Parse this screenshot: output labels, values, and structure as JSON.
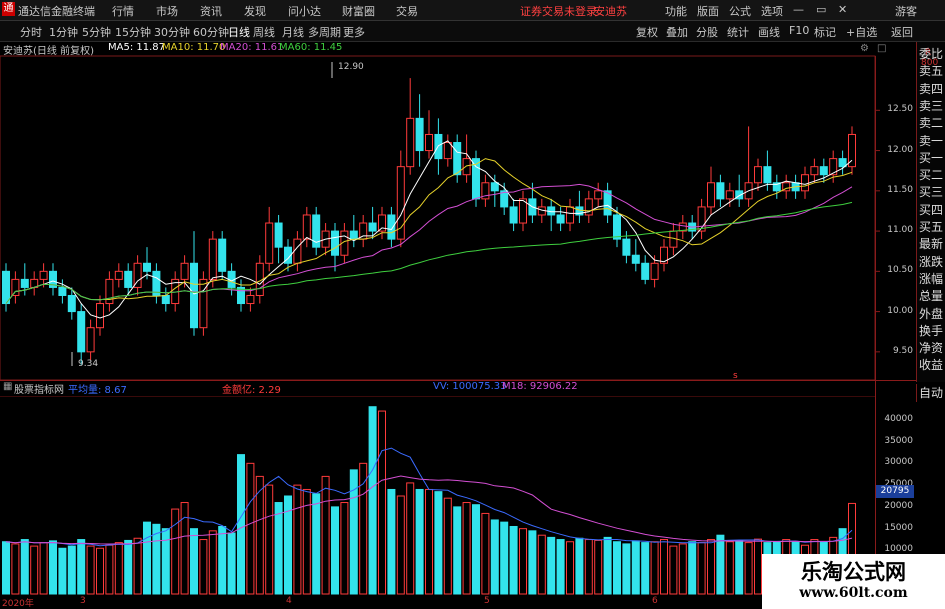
{
  "app": {
    "title": "通达信金融终端",
    "menus": [
      "行情",
      "市场",
      "资讯",
      "发现",
      "问小达",
      "财富圈",
      "交易"
    ],
    "alert": "证券交易未登录",
    "stock_tag": "安迪苏",
    "right_menus": [
      "功能",
      "版面",
      "公式",
      "选项"
    ],
    "guest": "游客",
    "colors": {
      "up": "#ff3b3b",
      "down": "#33e3ec",
      "ma5": "#ffffff",
      "ma10": "#e6d22b",
      "ma20": "#d34fd3",
      "ma60": "#3fcf3f"
    }
  },
  "toolbar": {
    "periods": [
      "分时",
      "1分钟",
      "5分钟",
      "15分钟",
      "30分钟",
      "60分钟",
      "日线",
      "周线",
      "月线",
      "多周期",
      "更多"
    ],
    "right_buttons": [
      "复权",
      "叠加",
      "分股",
      "统计",
      "画线",
      "F10",
      "标记",
      "+自选",
      "返回"
    ]
  },
  "chart_header": {
    "stock": "安迪苏(日线 前复权)",
    "ma5": "MA5: 11.87",
    "ma10": "MA10: 11.70",
    "ma20": "MA20: 11.61",
    "ma60": "MA60: 11.45"
  },
  "price_axis": [
    "12.50",
    "12.00",
    "11.50",
    "11.00",
    "10.50",
    "10.00",
    "9.50"
  ],
  "annotations": {
    "high": "12.90",
    "low": "9.34"
  },
  "side_panel": [
    "委比",
    "卖五",
    "卖四",
    "卖三",
    "卖二",
    "卖一",
    "买一",
    "买二",
    "买三",
    "买四",
    "买五",
    "最新",
    "涨跌",
    "涨幅",
    "总量",
    "外盘",
    "换手",
    "净资",
    "收益"
  ],
  "side_panel_bottom": "自动",
  "volume_panel": {
    "title": "股票指标网",
    "indicator1": "平均量: 8.67",
    "indicator2": "金额亿: 2.29",
    "vol": "VV: 100075.33",
    "m18": "M18: 92906.22",
    "axis": [
      "40000",
      "35000",
      "30000",
      "25000",
      "20000",
      "15000",
      "10000"
    ],
    "marker": "20795"
  },
  "date_axis": [
    "2020年",
    "3",
    "4",
    "5",
    "6"
  ],
  "watermark": {
    "title": "乐淘公式网",
    "url": "www.60lt.com"
  },
  "chart_data": {
    "type": "candlestick",
    "title": "安迪苏(日线 前复权)",
    "ylim": [
      9.2,
      13.1
    ],
    "candles": [
      [
        10.5,
        10.1,
        10.6,
        10.0
      ],
      [
        10.2,
        10.4,
        10.5,
        10.1
      ],
      [
        10.4,
        10.3,
        10.6,
        10.2
      ],
      [
        10.3,
        10.4,
        10.5,
        10.2
      ],
      [
        10.4,
        10.5,
        10.6,
        10.3
      ],
      [
        10.5,
        10.3,
        10.6,
        10.2
      ],
      [
        10.3,
        10.2,
        10.4,
        10.1
      ],
      [
        10.2,
        10.0,
        10.3,
        9.9
      ],
      [
        10.0,
        9.5,
        10.1,
        9.34
      ],
      [
        9.5,
        9.8,
        9.9,
        9.4
      ],
      [
        9.8,
        10.1,
        10.2,
        9.7
      ],
      [
        10.1,
        10.4,
        10.5,
        10.0
      ],
      [
        10.4,
        10.5,
        10.6,
        10.3
      ],
      [
        10.5,
        10.3,
        10.6,
        10.2
      ],
      [
        10.3,
        10.6,
        10.7,
        10.2
      ],
      [
        10.6,
        10.5,
        10.8,
        10.4
      ],
      [
        10.5,
        10.2,
        10.6,
        10.1
      ],
      [
        10.2,
        10.1,
        10.3,
        10.0
      ],
      [
        10.1,
        10.4,
        10.5,
        10.0
      ],
      [
        10.4,
        10.6,
        10.7,
        10.3
      ],
      [
        10.6,
        9.8,
        11.0,
        9.7
      ],
      [
        9.8,
        10.4,
        10.5,
        9.7
      ],
      [
        10.4,
        10.9,
        11.0,
        10.3
      ],
      [
        10.9,
        10.5,
        11.0,
        10.4
      ],
      [
        10.5,
        10.3,
        10.6,
        10.2
      ],
      [
        10.3,
        10.1,
        10.4,
        10.0
      ],
      [
        10.1,
        10.2,
        10.3,
        10.0
      ],
      [
        10.2,
        10.6,
        10.7,
        10.1
      ],
      [
        10.6,
        11.1,
        11.3,
        10.5
      ],
      [
        11.1,
        10.8,
        11.2,
        10.6
      ],
      [
        10.8,
        10.6,
        10.9,
        10.5
      ],
      [
        10.6,
        10.9,
        11.0,
        10.5
      ],
      [
        10.9,
        11.2,
        11.3,
        10.8
      ],
      [
        11.2,
        10.8,
        11.3,
        10.7
      ],
      [
        10.8,
        11.0,
        11.1,
        10.7
      ],
      [
        11.0,
        10.7,
        11.1,
        10.5
      ],
      [
        10.7,
        11.0,
        11.1,
        10.6
      ],
      [
        11.0,
        10.9,
        11.2,
        10.8
      ],
      [
        10.9,
        11.1,
        11.2,
        10.8
      ],
      [
        11.1,
        11.0,
        11.3,
        10.9
      ],
      [
        11.0,
        11.2,
        11.3,
        10.9
      ],
      [
        11.2,
        10.9,
        11.3,
        10.8
      ],
      [
        10.9,
        11.8,
        12.0,
        10.8
      ],
      [
        11.8,
        12.4,
        12.9,
        11.7
      ],
      [
        12.4,
        12.0,
        12.7,
        11.8
      ],
      [
        12.0,
        12.2,
        12.5,
        11.9
      ],
      [
        12.2,
        11.9,
        12.4,
        11.7
      ],
      [
        11.9,
        12.1,
        12.2,
        11.8
      ],
      [
        12.1,
        11.7,
        12.2,
        11.6
      ],
      [
        11.7,
        11.9,
        12.2,
        11.6
      ],
      [
        11.9,
        11.4,
        12.0,
        11.3
      ],
      [
        11.4,
        11.6,
        11.7,
        11.3
      ],
      [
        11.6,
        11.5,
        11.7,
        11.3
      ],
      [
        11.5,
        11.3,
        11.6,
        11.2
      ],
      [
        11.3,
        11.1,
        11.4,
        11.0
      ],
      [
        11.1,
        11.4,
        11.5,
        11.0
      ],
      [
        11.4,
        11.2,
        11.6,
        11.1
      ],
      [
        11.2,
        11.3,
        11.4,
        11.1
      ],
      [
        11.3,
        11.2,
        11.4,
        11.0
      ],
      [
        11.2,
        11.1,
        11.3,
        11.0
      ],
      [
        11.1,
        11.3,
        11.4,
        11.0
      ],
      [
        11.3,
        11.2,
        11.5,
        11.1
      ],
      [
        11.2,
        11.4,
        11.5,
        11.1
      ],
      [
        11.4,
        11.5,
        11.6,
        11.3
      ],
      [
        11.5,
        11.2,
        11.6,
        11.1
      ],
      [
        11.2,
        10.9,
        11.3,
        10.8
      ],
      [
        10.9,
        10.7,
        11.0,
        10.6
      ],
      [
        10.7,
        10.6,
        10.9,
        10.5
      ],
      [
        10.6,
        10.4,
        10.7,
        10.34
      ],
      [
        10.4,
        10.6,
        10.7,
        10.3
      ],
      [
        10.6,
        10.8,
        10.9,
        10.5
      ],
      [
        10.8,
        11.0,
        11.1,
        10.7
      ],
      [
        11.0,
        11.1,
        11.2,
        10.9
      ],
      [
        11.1,
        11.0,
        11.2,
        10.9
      ],
      [
        11.0,
        11.3,
        11.4,
        10.9
      ],
      [
        11.3,
        11.6,
        11.8,
        11.2
      ],
      [
        11.6,
        11.4,
        11.7,
        11.3
      ],
      [
        11.4,
        11.5,
        11.6,
        11.3
      ],
      [
        11.5,
        11.4,
        11.7,
        11.3
      ],
      [
        11.4,
        11.6,
        12.3,
        11.3
      ],
      [
        11.6,
        11.8,
        11.9,
        11.5
      ],
      [
        11.8,
        11.6,
        12.0,
        11.5
      ],
      [
        11.6,
        11.5,
        11.7,
        11.4
      ],
      [
        11.5,
        11.6,
        11.7,
        11.4
      ],
      [
        11.6,
        11.5,
        11.7,
        11.4
      ],
      [
        11.5,
        11.7,
        11.8,
        11.4
      ],
      [
        11.7,
        11.8,
        11.9,
        11.6
      ],
      [
        11.8,
        11.7,
        11.9,
        11.6
      ],
      [
        11.7,
        11.9,
        12.0,
        11.6
      ],
      [
        11.9,
        11.8,
        12.0,
        11.7
      ],
      [
        11.8,
        12.2,
        12.3,
        11.7
      ]
    ],
    "volumes": [
      12000,
      11500,
      12500,
      11000,
      11800,
      12200,
      10500,
      11000,
      12500,
      11000,
      10500,
      11200,
      11800,
      12300,
      12800,
      16500,
      16000,
      15000,
      19500,
      21000,
      15000,
      12500,
      14500,
      15500,
      14000,
      32000,
      30000,
      27000,
      25000,
      21000,
      22500,
      25000,
      24000,
      23000,
      27000,
      20000,
      21000,
      28500,
      30000,
      43000,
      42000,
      24000,
      22500,
      25500,
      24000,
      24000,
      23500,
      22000,
      20000,
      21000,
      20500,
      18500,
      17000,
      16500,
      15500,
      15000,
      14500,
      13500,
      13000,
      12500,
      12000,
      12800,
      12500,
      12300,
      13000,
      12000,
      11500,
      12200,
      11800,
      12000,
      12500,
      11000,
      11500,
      12000,
      11800,
      12500,
      13500,
      12000,
      12200,
      11800,
      12600,
      11800,
      12000,
      12500,
      11900,
      11200,
      12500,
      12000,
      13000,
      15000,
      20795
    ],
    "vol_ylim": [
      0,
      45000
    ]
  }
}
